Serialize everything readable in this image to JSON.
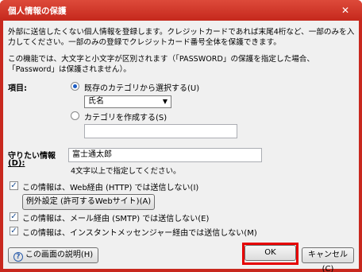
{
  "window": {
    "title": "個人情報の保護",
    "close_symbol": "✕"
  },
  "intro": {
    "text": "外部に送信したくない個人情報を登録します。クレジットカードであれば末尾4桁など、一部のみを入力してください。一部のみの登録でクレジットカード番号全体を保護できます。"
  },
  "note": {
    "text": "この機能では、大文字と小文字が区別されます（「PASSWORD」の保護を指定した場合、「Password」は保護されません）。"
  },
  "item": {
    "label": "項目:",
    "radio_existing_label": "既存のカテゴリから選択する(U)",
    "select_value": "氏名",
    "radio_create_label": "カテゴリを作成する(S)",
    "create_value": ""
  },
  "info": {
    "label_line1": "守りたい情報",
    "label_line2": "(D):",
    "value": "富士通太郎",
    "hint": "4文字以上で指定してください。"
  },
  "options": {
    "web_label": "この情報は、Web経由 (HTTP) では送信しない(I)",
    "exceptions_button": "例外設定 (許可するWebサイト)(A)",
    "smtp_label": "この情報は、メール経由 (SMTP) では送信しない(E)",
    "im_label": "この情報は、インスタントメッセンジャー経由では送信しない(M)"
  },
  "footer": {
    "help_button": "この画面の説明(H)",
    "ok_button": "OK",
    "cancel_button": "キャンセル(C)"
  },
  "colors": {
    "titlebar": "#c8281e",
    "highlight": "#e60000"
  }
}
